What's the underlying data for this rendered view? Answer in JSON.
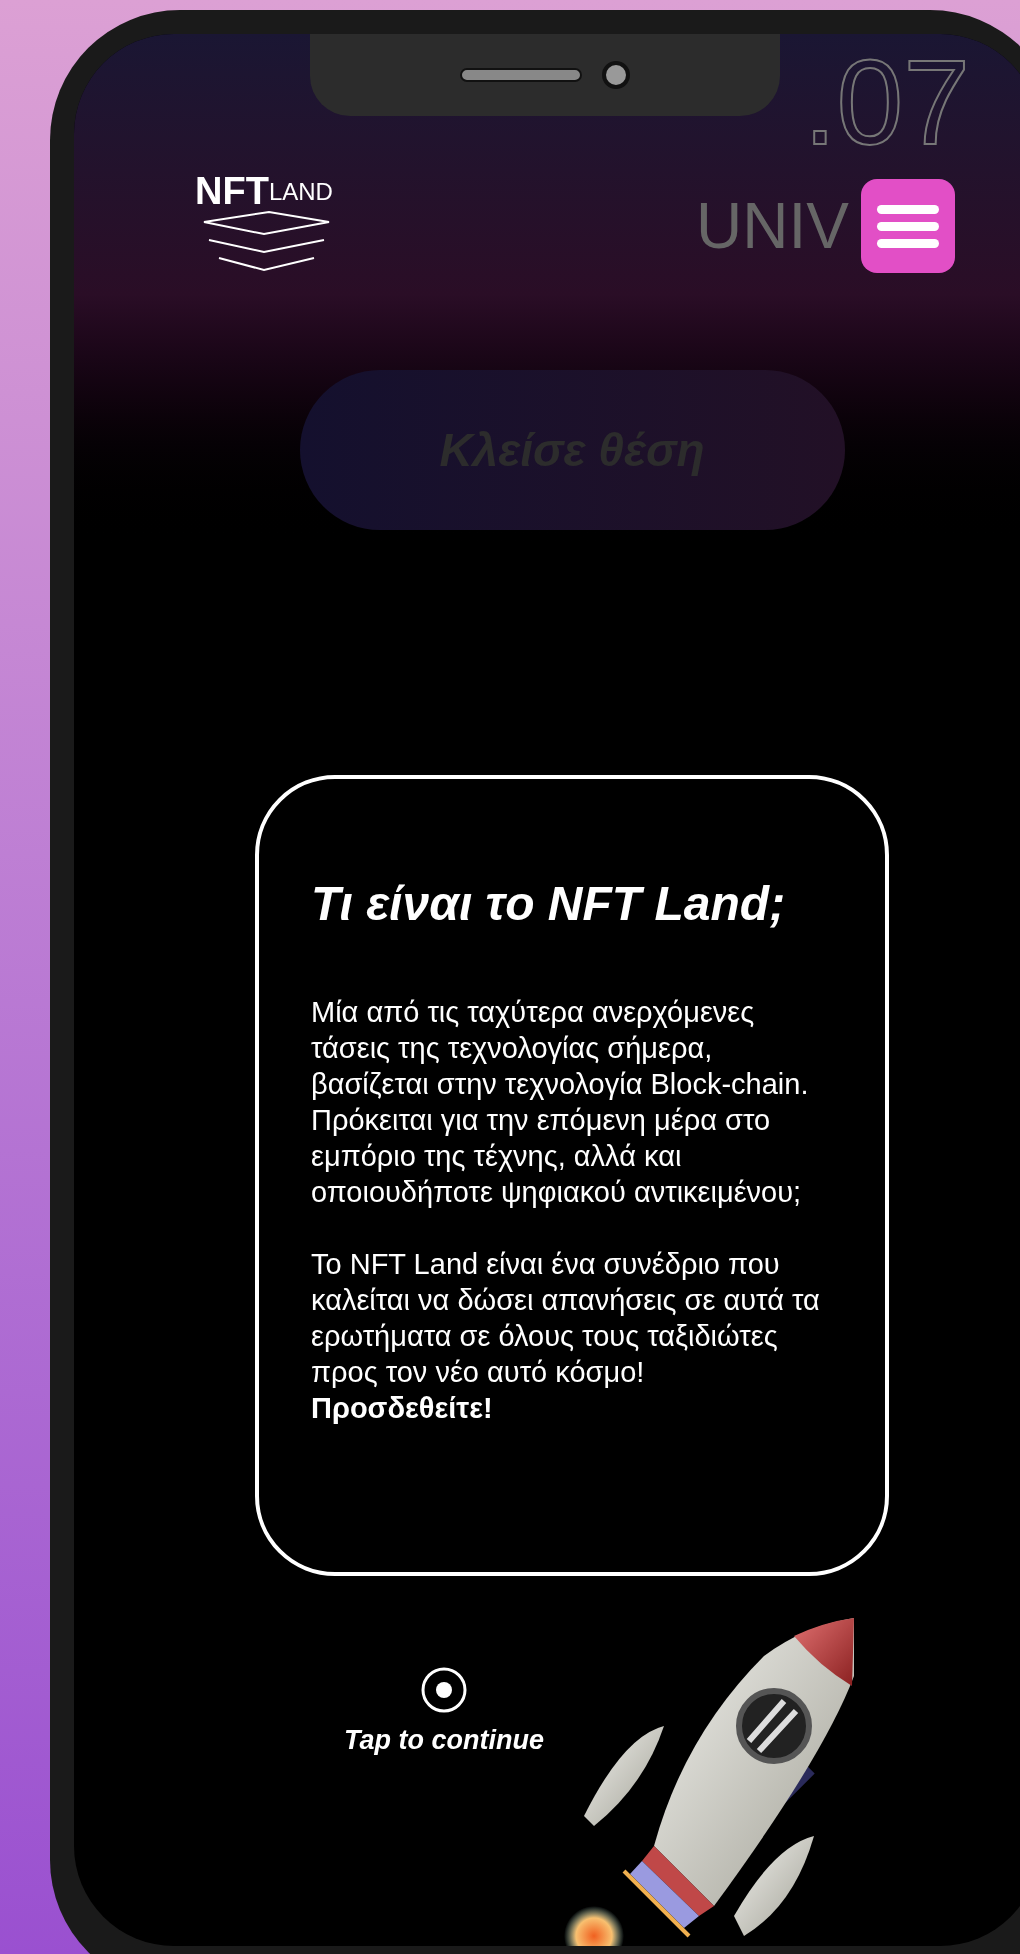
{
  "hero": {
    "date": ".07",
    "venue": "UNIV"
  },
  "logo": {
    "main": "NFT",
    "sub": "LAND"
  },
  "book_button": {
    "label": "Κλείσε θέση",
    "disabled": true
  },
  "info_card": {
    "title": "Τι είναι το NFT Land;",
    "paragraphs": [
      "Μία από τις ταχύτερα ανερχόμενες τάσεις της τεχνολογίας σήμερα, βασίζεται στην τεχνολογία Block-chain. Πρόκειται για την επόμενη μέρα στο εμπόριο της τέχνης, αλλά και οποιουδήποτε ψηφιακού αντικειμένου;",
      "Το NFT Land είναι ένα συνέδριο που καλείται να δώσει απανήσεις σε αυτά τα ερωτήματα σε όλους τους ταξιδιώτες προς τον νέο αυτό κόσμο! **Προσδεθείτε!**"
    ]
  },
  "tap_hint": "Tap to continue"
}
